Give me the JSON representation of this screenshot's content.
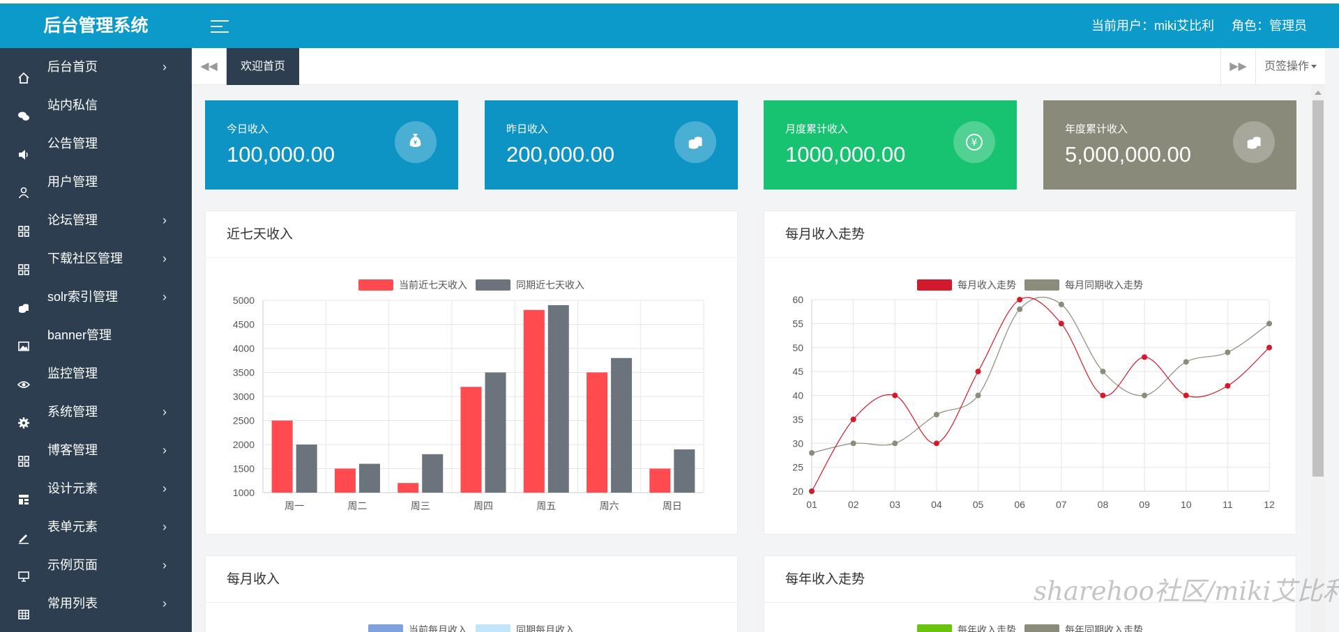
{
  "header": {
    "app_title": "后台管理系统",
    "current_user": "当前用户：miki艾比利",
    "role": "角色：管理员"
  },
  "sidebar": {
    "items": [
      {
        "label": "后台首页",
        "icon": "home-icon",
        "arrow": true
      },
      {
        "label": "站内私信",
        "icon": "chat-icon",
        "arrow": false
      },
      {
        "label": "公告管理",
        "icon": "speaker-icon",
        "arrow": false
      },
      {
        "label": "用户管理",
        "icon": "user-icon",
        "arrow": false
      },
      {
        "label": "论坛管理",
        "icon": "grid-icon",
        "arrow": true
      },
      {
        "label": "下载社区管理",
        "icon": "grid-icon",
        "arrow": true
      },
      {
        "label": "solr索引管理",
        "icon": "coins-icon",
        "arrow": true
      },
      {
        "label": "banner管理",
        "icon": "image-icon",
        "arrow": false
      },
      {
        "label": "监控管理",
        "icon": "eye-icon",
        "arrow": false
      },
      {
        "label": "系统管理",
        "icon": "gear-icon",
        "arrow": true
      },
      {
        "label": "博客管理",
        "icon": "grid-icon",
        "arrow": true
      },
      {
        "label": "设计元素",
        "icon": "layout-icon",
        "arrow": true
      },
      {
        "label": "表单元素",
        "icon": "pencil-icon",
        "arrow": true
      },
      {
        "label": "示例页面",
        "icon": "monitor-icon",
        "arrow": true
      },
      {
        "label": "常用列表",
        "icon": "table-icon",
        "arrow": true
      }
    ],
    "arrow_glyph": "›"
  },
  "tabs": {
    "active": "欢迎首页",
    "prev_glyph": "◀◀",
    "next_glyph": "▶▶",
    "ops_label": "页签操作"
  },
  "stats": [
    {
      "title": "今日收入",
      "value": "100,000.00",
      "color": "#0e94c4",
      "icon": "money-bag-icon"
    },
    {
      "title": "昨日收入",
      "value": "200,000.00",
      "color": "#0e94c4",
      "icon": "coins-icon"
    },
    {
      "title": "月度累计收入",
      "value": "1000,000.00",
      "color": "#17c271",
      "icon": "yen-icon"
    },
    {
      "title": "年度累计收入",
      "value": "5,000,000.00",
      "color": "#8a8a7b",
      "icon": "coins-icon"
    }
  ],
  "panels": {
    "weekly_title": "近七天收入",
    "monthly_trend_title": "每月收入走势",
    "monthly_title": "每月收入",
    "yearly_trend_title": "每年收入走势"
  },
  "chart_data": [
    {
      "type": "bar",
      "title": "近七天收入",
      "categories": [
        "周一",
        "周二",
        "周三",
        "周四",
        "周五",
        "周六",
        "周日"
      ],
      "series": [
        {
          "name": "当前近七天收入",
          "color": "#ff4a4f",
          "values": [
            2500,
            1500,
            1200,
            3200,
            4800,
            3500,
            1500
          ]
        },
        {
          "name": "同期近七天收入",
          "color": "#6b737c",
          "values": [
            2000,
            1600,
            1800,
            3500,
            4900,
            3800,
            1900
          ]
        }
      ],
      "ylim": [
        1000,
        5000
      ],
      "yticks": [
        1000,
        1500,
        2000,
        2500,
        3000,
        3500,
        4000,
        4500,
        5000
      ],
      "grid": true,
      "legend": "top-center"
    },
    {
      "type": "line",
      "title": "每月收入走势",
      "categories": [
        "01",
        "02",
        "03",
        "04",
        "05",
        "06",
        "07",
        "08",
        "09",
        "10",
        "11",
        "12"
      ],
      "series": [
        {
          "name": "每月收入走势",
          "color": "#d3192c",
          "values": [
            20,
            35,
            40,
            30,
            45,
            60,
            55,
            40,
            48,
            40,
            42,
            50
          ]
        },
        {
          "name": "每月同期收入走势",
          "color": "#8b8c7c",
          "values": [
            28,
            30,
            30,
            36,
            40,
            58,
            59,
            45,
            40,
            47,
            49,
            55
          ]
        }
      ],
      "ylim": [
        20,
        60
      ],
      "yticks": [
        20,
        25,
        30,
        35,
        40,
        45,
        50,
        55,
        60
      ],
      "grid": true,
      "legend": "top-center"
    },
    {
      "type": "bar",
      "title": "每月收入",
      "series": [
        {
          "name": "当前每月收入",
          "color": "#7ea2dd"
        },
        {
          "name": "同期每月收入",
          "color": "#c2e5fa"
        }
      ],
      "legend": "top-center"
    },
    {
      "type": "line",
      "title": "每年收入走势",
      "series": [
        {
          "name": "每年收入走势",
          "color": "#6ac30c"
        },
        {
          "name": "每年同期收入走势",
          "color": "#8b8c7c"
        }
      ],
      "legend": "top-center"
    }
  ],
  "watermark": "sharehoo社区/miki艾比利"
}
